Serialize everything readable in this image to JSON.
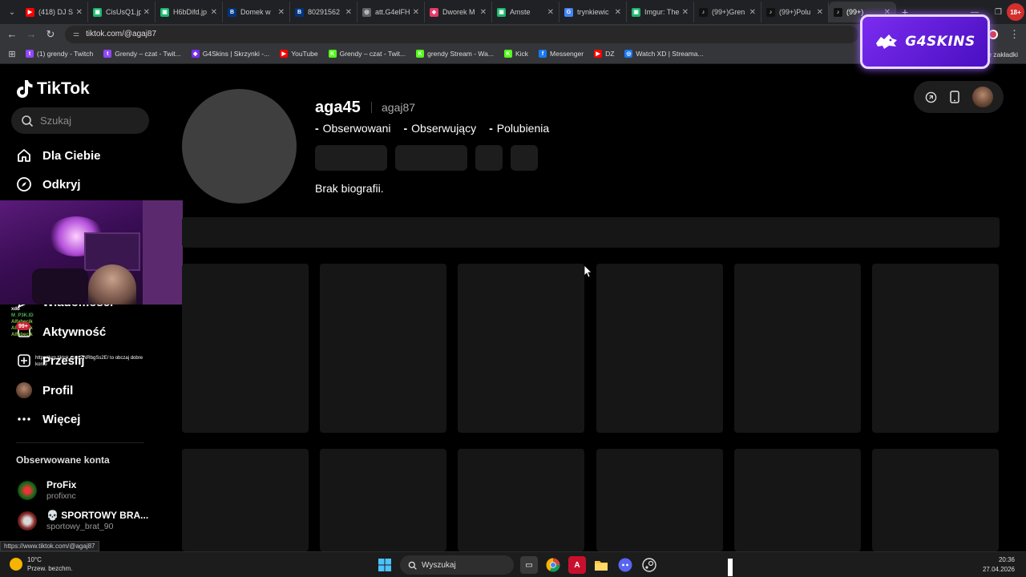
{
  "browser": {
    "tabs": [
      {
        "title": "(418) DJ S",
        "color": "#ff0000",
        "glyph": "▶"
      },
      {
        "title": "CisUsQ1.jp",
        "color": "#1bb76e",
        "glyph": "▣"
      },
      {
        "title": "H6bDifd.jp",
        "color": "#1bb76e",
        "glyph": "▣"
      },
      {
        "title": "Domek w",
        "color": "#003580",
        "glyph": "B"
      },
      {
        "title": "80291562",
        "color": "#003580",
        "glyph": "B"
      },
      {
        "title": "att.G4elFH",
        "color": "#5f6368",
        "glyph": "◎"
      },
      {
        "title": "Dworek M",
        "color": "#e7396b",
        "glyph": "◈"
      },
      {
        "title": "Amste",
        "color": "#1bb76e",
        "glyph": "▣"
      },
      {
        "title": "trynkiewic",
        "color": "#4285f4",
        "glyph": "G"
      },
      {
        "title": "Imgur: The",
        "color": "#1bb76e",
        "glyph": "▣"
      },
      {
        "title": "(99+)Gren",
        "color": "#111111",
        "glyph": "♪"
      },
      {
        "title": "(99+)Polu",
        "color": "#111111",
        "glyph": "♪"
      },
      {
        "title": "(99+)",
        "color": "#111111",
        "glyph": "♪"
      }
    ],
    "active_tab_index": 12,
    "url": "tiktok.com/@agaj87",
    "age_badge": "18+",
    "bookmarks": [
      {
        "label": "(1) grendy - Twitch",
        "color": "#9146ff",
        "glyph": "t"
      },
      {
        "label": "Grendy – czat - Twit...",
        "color": "#9146ff",
        "glyph": "t"
      },
      {
        "label": "G4Skins | Skrzynki -...",
        "color": "#7b2cf0",
        "glyph": "◆"
      },
      {
        "label": "YouTube",
        "color": "#ff0000",
        "glyph": "▶"
      },
      {
        "label": "Grendy – czat - Twit...",
        "color": "#53fc18",
        "glyph": "K"
      },
      {
        "label": "grendy Stream - Wa...",
        "color": "#53fc18",
        "glyph": "K"
      },
      {
        "label": "Kick",
        "color": "#53fc18",
        "glyph": "K"
      },
      {
        "label": "Messenger",
        "color": "#1877f2",
        "glyph": "f"
      },
      {
        "label": "DZ",
        "color": "#ff0000",
        "glyph": "▶"
      },
      {
        "label": "Watch XD | Streama...",
        "color": "#1877f2",
        "glyph": "◎"
      }
    ],
    "bookmarks_other": "e zakładki"
  },
  "overlay": {
    "brand": "G4SKINS"
  },
  "sidebar": {
    "logo_text": "TikTok",
    "search_placeholder": "Szukaj",
    "nav": [
      {
        "label": "Dla Ciebie",
        "icon": "home-icon"
      },
      {
        "label": "Odkryj",
        "icon": "compass-icon"
      },
      {
        "label": "Wiadomości",
        "icon": "messages-icon"
      },
      {
        "label": "Aktywność",
        "icon": "activity-icon"
      },
      {
        "label": "Prześlij",
        "icon": "upload-icon"
      },
      {
        "label": "Profil",
        "icon": "profile-avatar"
      },
      {
        "label": "Więcej",
        "icon": "more-icon"
      }
    ],
    "followed_title": "Obserwowane konta",
    "followed": [
      {
        "name": "ProFix",
        "username": "profixnc"
      },
      {
        "name": "💀 SPORTOWY BRA...",
        "username": "sportowy_brat_90"
      }
    ]
  },
  "chat": {
    "lines": [
      {
        "user": "",
        "text": "xdd",
        "color": "#e53935"
      },
      {
        "user": "M_P3K.ID",
        "text": "",
        "color": "#4caf50"
      },
      {
        "user": "",
        "text": "",
        "color": "#4caf50"
      },
      {
        "user": "Alfabecik",
        "text": "",
        "color": "#8bc34a"
      },
      {
        "user": "Alfabecik",
        "text": "",
        "color": "#8bc34a"
      },
      {
        "user": "Alfabecik",
        "text": "",
        "color": "#8bc34a"
      }
    ],
    "badge": "99+",
    "link_text": "https://vm.tiktok.com/ZNRbgSs2E/ to obczaj dobre konto"
  },
  "profile": {
    "username": "aga45",
    "nickname": "agaj87",
    "stats": [
      {
        "value": "-",
        "label": "Obserwowani"
      },
      {
        "value": "-",
        "label": "Obserwujący"
      },
      {
        "value": "-",
        "label": "Polubienia"
      }
    ],
    "bio": "Brak biografii."
  },
  "status_url": "https://www.tiktok.com/@agaj87",
  "taskbar": {
    "temp": "10°C",
    "weather": "Przew. bezchm.",
    "search": "Wyszukaj",
    "time": "20:36",
    "date": "27.04.2026"
  }
}
